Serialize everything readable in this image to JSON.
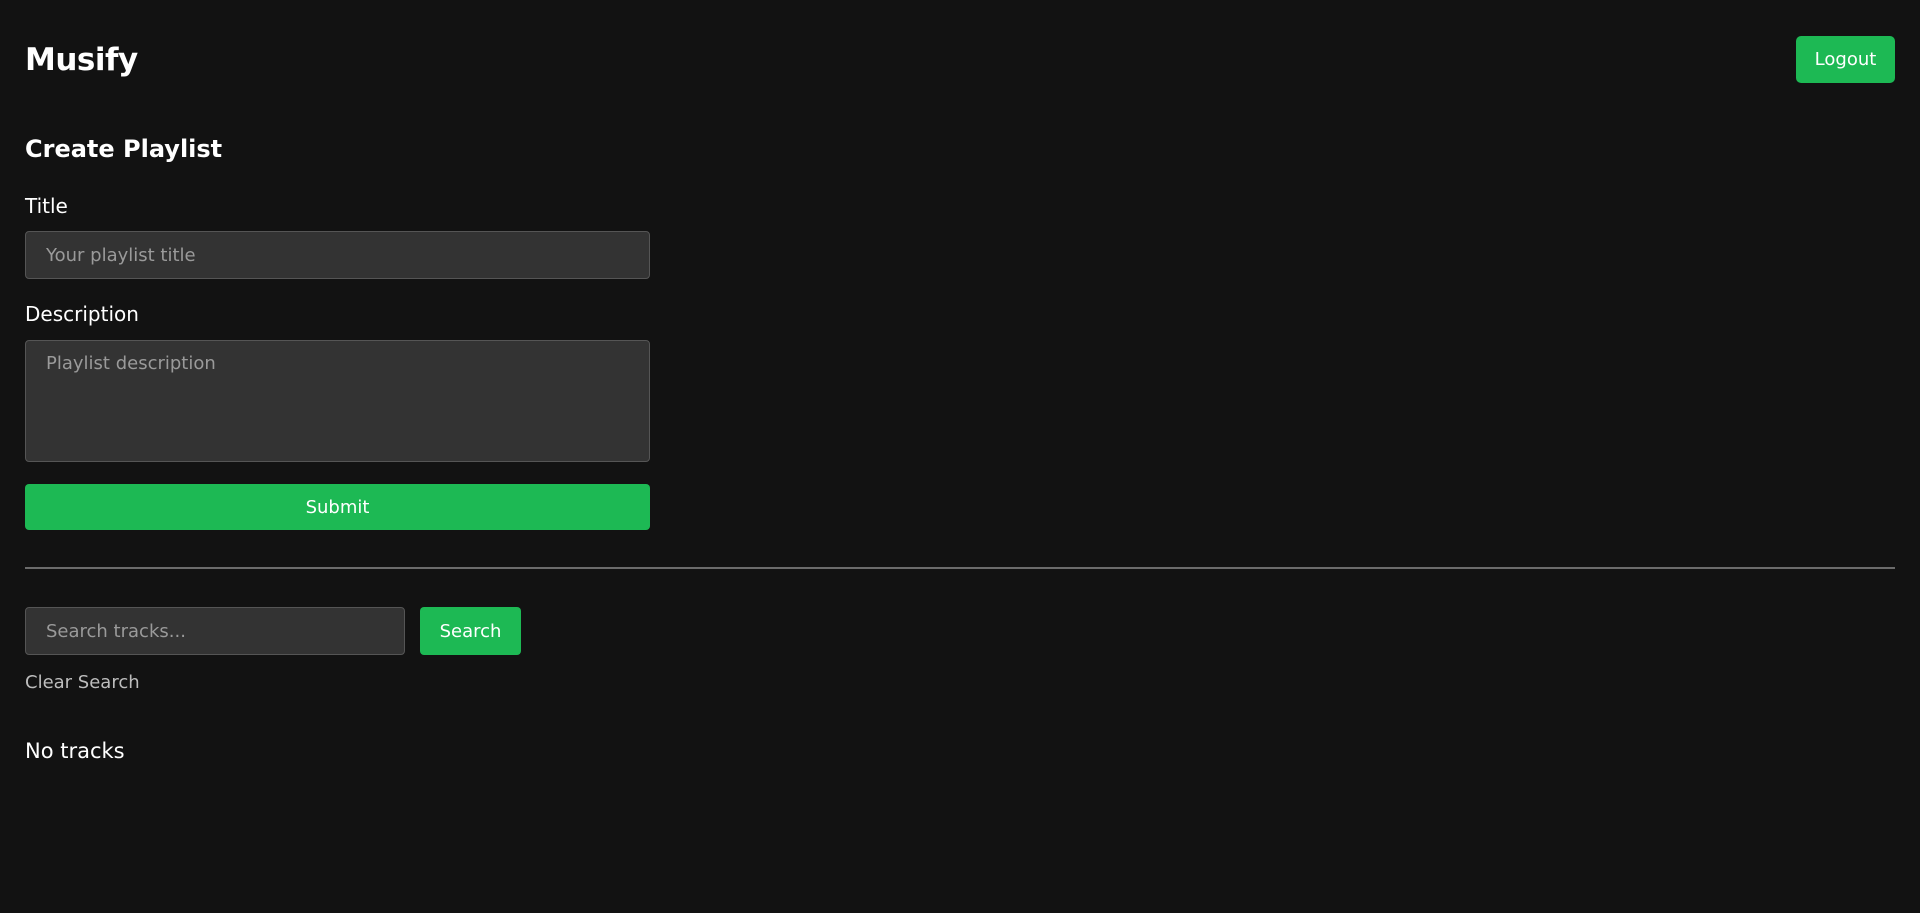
{
  "app": {
    "name": "Musify"
  },
  "header": {
    "logout_label": "Logout"
  },
  "create_playlist": {
    "heading": "Create Playlist",
    "title_label": "Title",
    "title_value": "",
    "title_placeholder": "Your playlist title",
    "description_label": "Description",
    "description_value": "",
    "description_placeholder": "Playlist description",
    "submit_label": "Submit"
  },
  "search": {
    "value": "",
    "placeholder": "Search tracks...",
    "button_label": "Search",
    "clear_label": "Clear Search"
  },
  "tracks": {
    "empty_message": "No tracks",
    "items": []
  },
  "colors": {
    "background": "#121212",
    "accent": "#1db954",
    "input_background": "#333333",
    "input_border": "#555555",
    "divider": "#6b6b6b",
    "muted_text": "#bdbdbd"
  }
}
